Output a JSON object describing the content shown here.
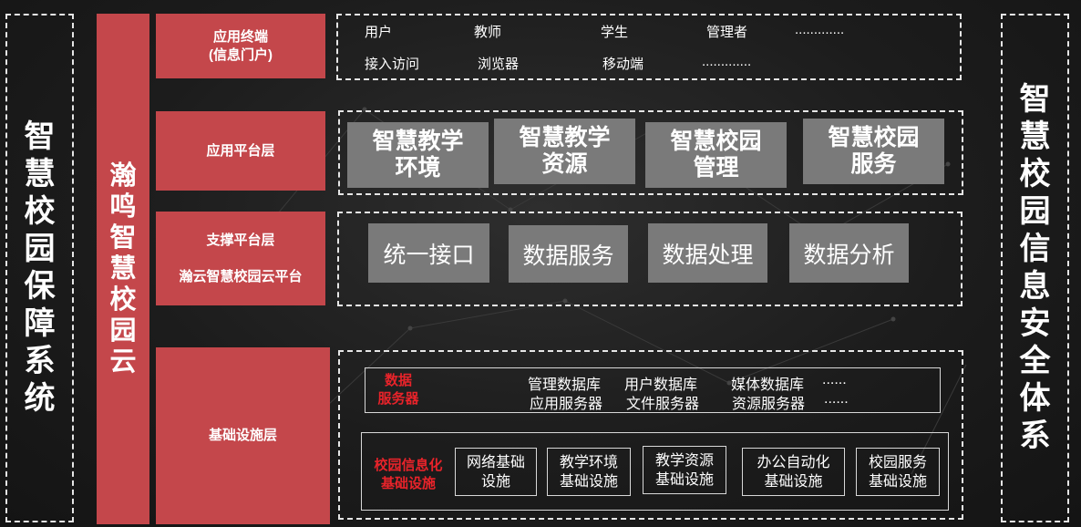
{
  "left_system": "智慧校园保障系统",
  "right_system": "智慧校园信息安全体系",
  "cloud_name": "瀚鸣智慧校园云",
  "layers": {
    "terminal": {
      "line1": "应用终端",
      "line2": "(信息门户)"
    },
    "app_platform": "应用平台层",
    "support": {
      "line1": "支撑平台层",
      "line2": "瀚云智慧校园云平台"
    },
    "infrastructure": "基础设施层"
  },
  "terminal_row1": [
    "用户",
    "教师",
    "学生",
    "管理者",
    "............."
  ],
  "terminal_row2": [
    "接入访问",
    "浏览器",
    "移动端",
    "............."
  ],
  "app_boxes": [
    {
      "l1": "智慧教学",
      "l2": "环境"
    },
    {
      "l1": "智慧教学",
      "l2": "资源"
    },
    {
      "l1": "智慧校园",
      "l2": "管理"
    },
    {
      "l1": "智慧校园",
      "l2": "服务"
    }
  ],
  "support_boxes": [
    "统一接口",
    "数据服务",
    "数据处理",
    "数据分析"
  ],
  "data_server": {
    "label_l1": "数据",
    "label_l2": "服务器",
    "row1": [
      "管理数据库",
      "用户数据库",
      "媒体数据库",
      "......"
    ],
    "row2": [
      "应用服务器",
      "文件服务器",
      "资源服务器",
      "......"
    ]
  },
  "campus_infra": {
    "label_l1": "校园信息化",
    "label_l2": "基础设施",
    "boxes": [
      {
        "l1": "网络基础",
        "l2": "设施"
      },
      {
        "l1": "教学环境",
        "l2": "基础设施"
      },
      {
        "l1": "教学资源",
        "l2": "基础设施"
      },
      {
        "l1": "办公自动化",
        "l2": "基础设施"
      },
      {
        "l1": "校园服务",
        "l2": "基础设施"
      }
    ]
  }
}
